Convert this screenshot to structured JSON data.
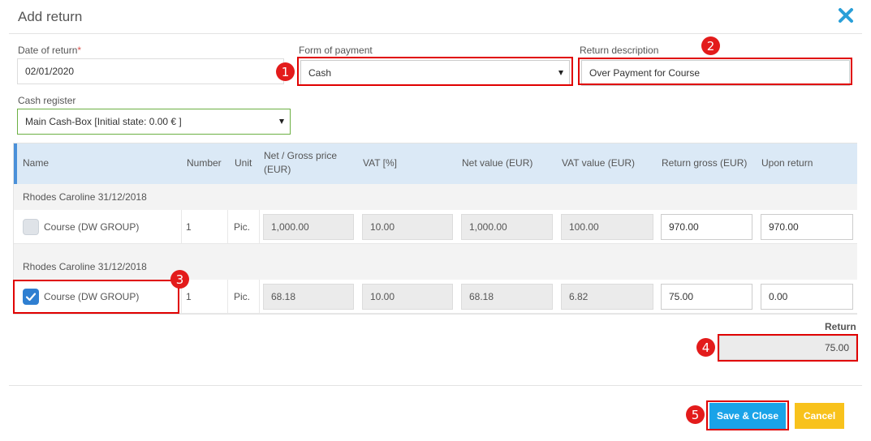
{
  "dialog": {
    "title": "Add return"
  },
  "fields": {
    "date_label": "Date of return",
    "date_required": "*",
    "date_value": "02/01/2020",
    "payment_label": "Form of payment",
    "payment_value": "Cash",
    "desc_label": "Return description",
    "desc_value": "Over Payment for Course",
    "register_label": "Cash register",
    "register_value": "Main Cash-Box [Initial state: 0.00 € ]"
  },
  "table": {
    "headers": {
      "name": "Name",
      "number": "Number",
      "unit": "Unit",
      "price_line1": "Net / Gross price",
      "price_line2": "(EUR)",
      "vat": "VAT [%]",
      "net_value": "Net value (EUR)",
      "vat_value": "VAT value (EUR)",
      "return_gross": "Return gross (EUR)",
      "upon_return": "Upon return"
    },
    "groups": [
      {
        "title": "Rhodes Caroline 31/12/2018",
        "row": {
          "checked": false,
          "name": "Course (DW GROUP)",
          "number": "1",
          "unit": "Pic.",
          "price": "1,000.00",
          "vat": "10.00",
          "net_value": "1,000.00",
          "vat_value": "100.00",
          "return_gross": "970.00",
          "upon_return": "970.00"
        }
      },
      {
        "title": "Rhodes Caroline 31/12/2018",
        "row": {
          "checked": true,
          "name": "Course (DW GROUP)",
          "number": "1",
          "unit": "Pic.",
          "price": "68.18",
          "vat": "10.00",
          "net_value": "68.18",
          "vat_value": "6.82",
          "return_gross": "75.00",
          "upon_return": "0.00"
        }
      }
    ]
  },
  "summary": {
    "return_label": "Return",
    "return_value": "75.00"
  },
  "buttons": {
    "save": "Save & Close",
    "cancel": "Cancel"
  },
  "annotations": [
    "1",
    "2",
    "3",
    "4",
    "5"
  ],
  "colors": {
    "annotation_red": "#e31b1b",
    "save_blue": "#1aa3e8",
    "cancel_yellow": "#f8c21c",
    "header_blue": "#dbe9f6",
    "check_blue": "#2f7fd1"
  }
}
